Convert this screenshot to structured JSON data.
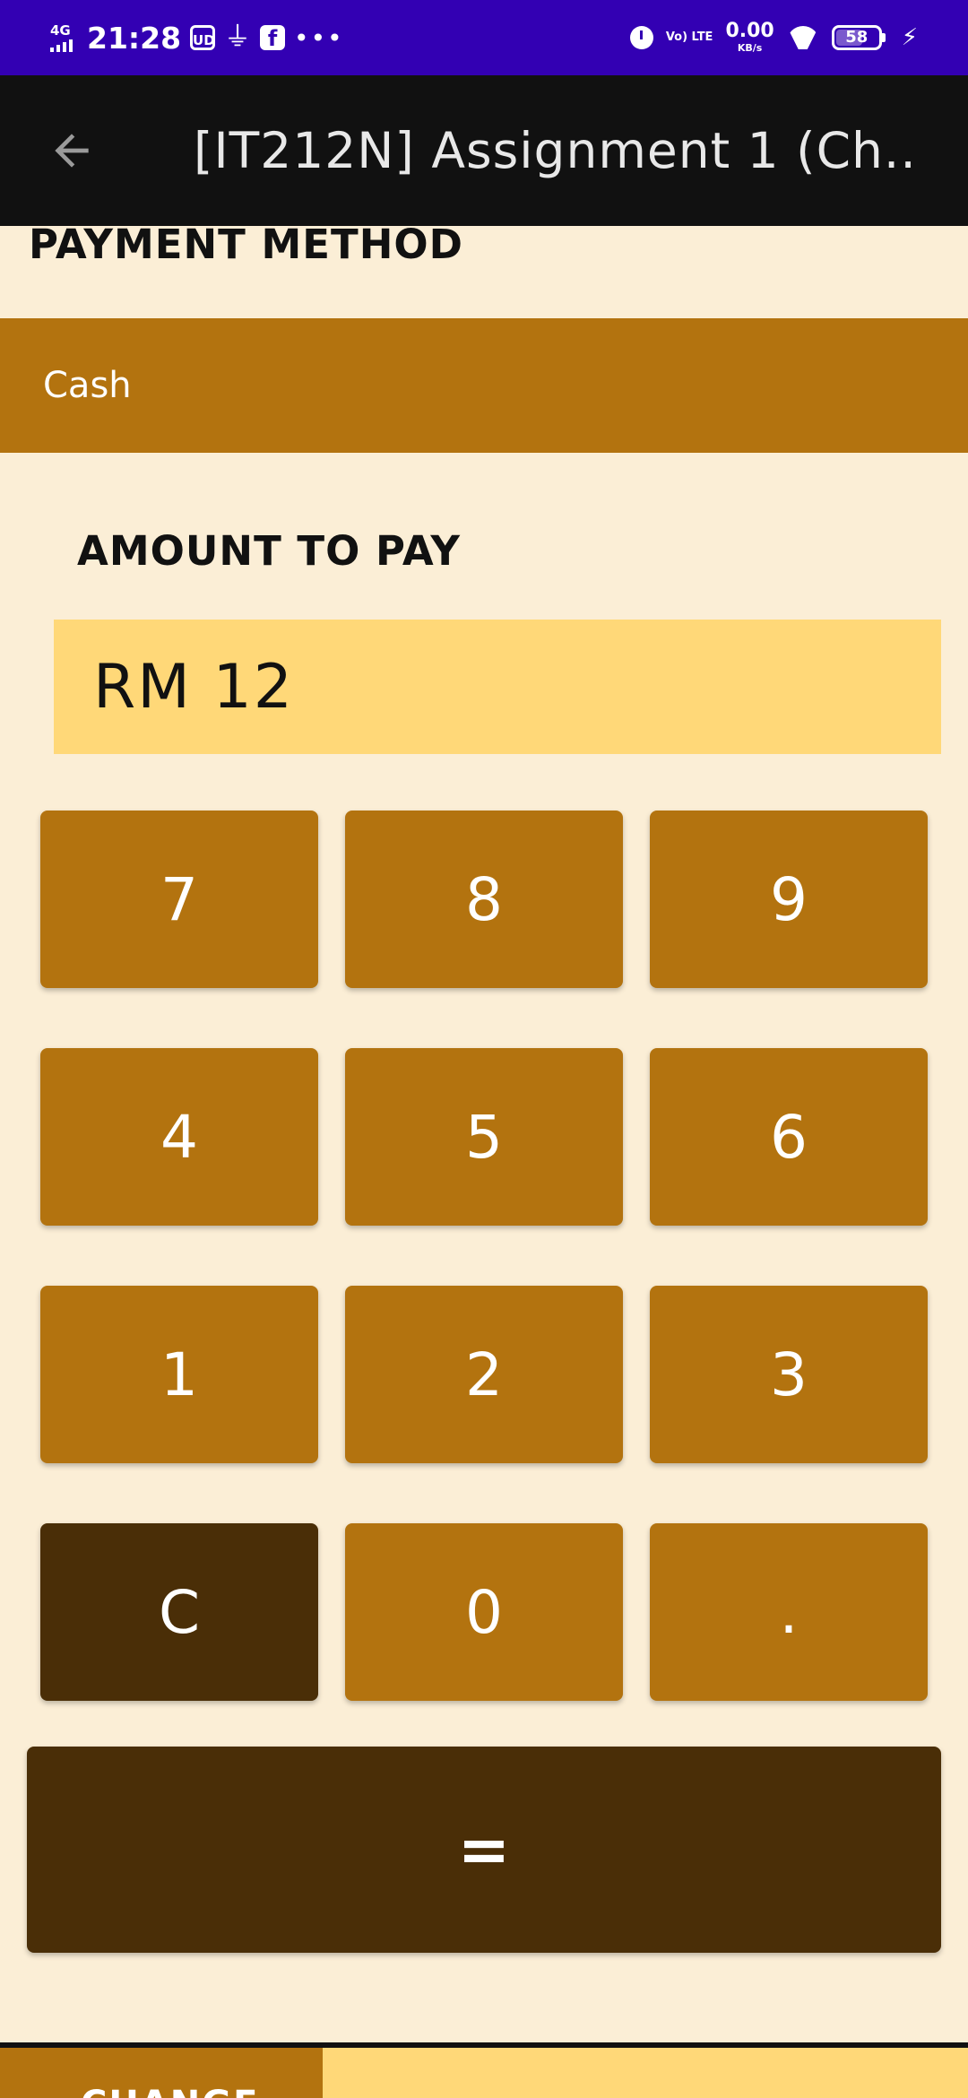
{
  "status_bar": {
    "network": "4G",
    "time": "21:28",
    "usb_debug_label": "UD",
    "usb_symbol": "⏚",
    "fb_letter": "f",
    "more": "•••",
    "volte": "Vo) LTE",
    "speed_value": "0.00",
    "speed_unit": "KB/s",
    "battery": "58",
    "charging": "⚡"
  },
  "app_bar": {
    "title": "[IT212N] Assignment 1 (Ch..."
  },
  "payment": {
    "heading": "PAYMENT METHOD",
    "method": "Cash"
  },
  "amount": {
    "heading": "AMOUNT TO PAY",
    "value": "RM 12"
  },
  "keypad": {
    "k7": "7",
    "k8": "8",
    "k9": "9",
    "k4": "4",
    "k5": "5",
    "k6": "6",
    "k1": "1",
    "k2": "2",
    "k3": "3",
    "kc": "C",
    "k0": "0",
    "kdot": ".",
    "equals": "="
  },
  "bottom": {
    "left_label": "CHANGE"
  },
  "colors": {
    "status_bar": "#3300b3",
    "app_bar": "#111111",
    "background": "#fbeed6",
    "key": "#b3730f",
    "key_dark": "#4a2e07",
    "amount_bg": "#ffd878"
  }
}
